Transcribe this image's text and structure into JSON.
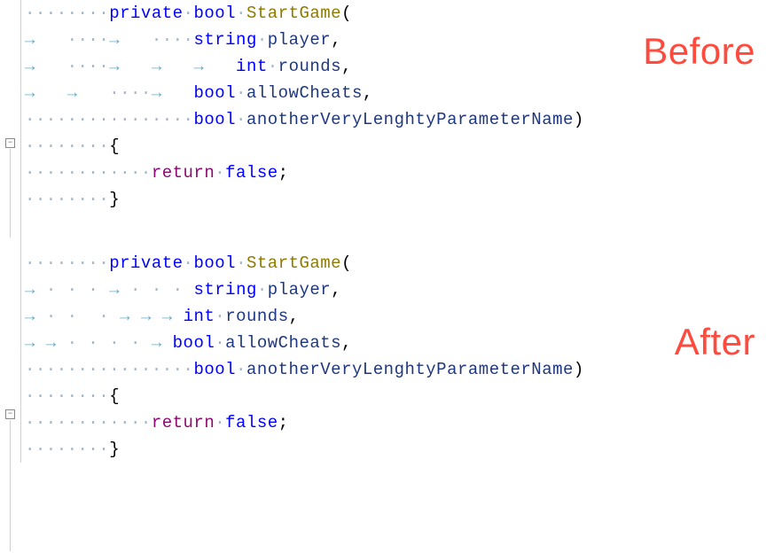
{
  "labels": {
    "before": "Before",
    "after": "After"
  },
  "code": {
    "keyword_private": "private",
    "keyword_bool": "bool",
    "keyword_string": "string",
    "keyword_int": "int",
    "keyword_return": "return",
    "keyword_false": "false",
    "method_name": "StartGame",
    "param_player": "player",
    "param_rounds": "rounds",
    "param_allowCheats": "allowCheats",
    "param_lengthy": "anotherVeryLenghtyParameterName",
    "brace_open": "{",
    "brace_close": "}",
    "paren_open": "(",
    "paren_close": ")",
    "comma": ",",
    "semicolon": ";"
  },
  "fold_marker": "−"
}
